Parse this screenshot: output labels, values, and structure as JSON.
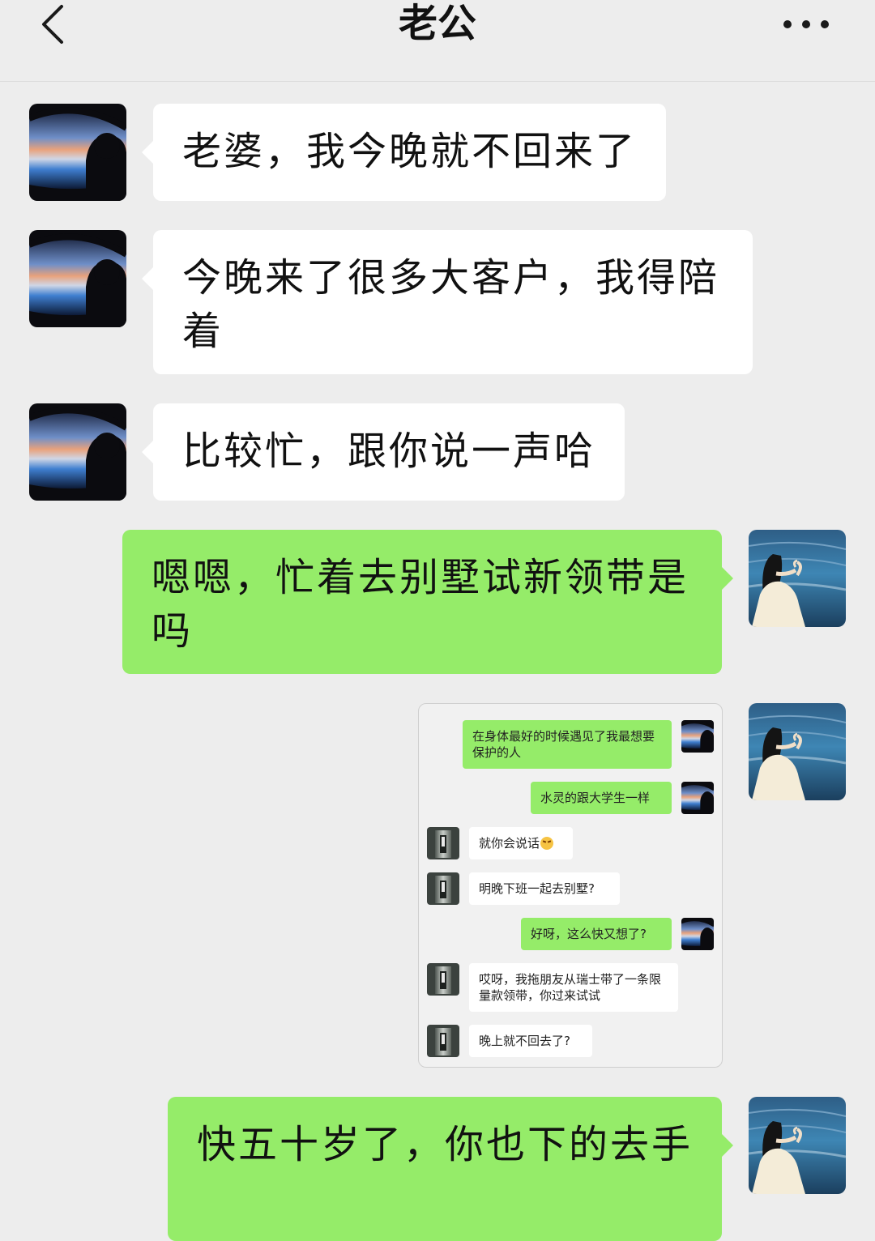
{
  "header": {
    "title": "老公",
    "back_icon": "chevron-left-icon",
    "more_icon": "more-dots-icon"
  },
  "messages": [
    {
      "side": "left",
      "text": "老婆，我今晚就不回来了"
    },
    {
      "side": "left",
      "text": "今晚来了很多大客户，我得陪着"
    },
    {
      "side": "left",
      "text": "比较忙，跟你说一声哈"
    },
    {
      "side": "right",
      "text": "嗯嗯，忙着去别墅试新领带是吗"
    },
    {
      "side": "right",
      "type": "image",
      "description": "shared chat screenshot"
    },
    {
      "side": "right",
      "text": "快五十岁了，你也下的去手"
    }
  ],
  "shared_screenshot": {
    "messages": [
      {
        "side": "right",
        "text": "在身体最好的时候遇见了我最想要保护的人"
      },
      {
        "side": "right",
        "text": "水灵的跟大学生一样"
      },
      {
        "side": "left",
        "text": "就你会说话",
        "emoji": "angry-face-emoji"
      },
      {
        "side": "left",
        "text": "明晚下班一起去别墅?"
      },
      {
        "side": "right",
        "text": "好呀，这么快又想了?"
      },
      {
        "side": "left",
        "text": "哎呀，我拖朋友从瑞士带了一条限量款领带，你过来试试"
      },
      {
        "side": "left",
        "text": "晚上就不回去了?"
      }
    ]
  },
  "colors": {
    "background": "#ededed",
    "incoming_bubble": "#ffffff",
    "outgoing_bubble": "#95ec69"
  }
}
